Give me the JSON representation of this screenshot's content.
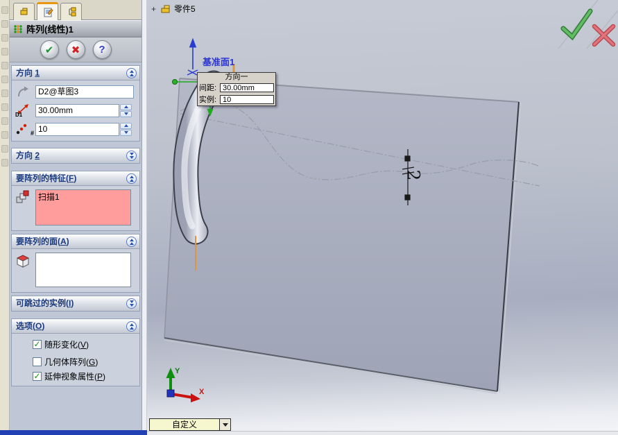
{
  "panel": {
    "title": "阵列(线性)1",
    "buttons": {
      "ok_glyph": "✔",
      "cancel_glyph": "✖",
      "help_glyph": "?"
    },
    "direction1": {
      "label": "方向 1",
      "direction_field": "D2@草图3",
      "spacing_value": "30.00mm",
      "spacing_icon_label": "D1",
      "count_value": "10",
      "count_icon_label": "#"
    },
    "direction2": {
      "label": "方向 2"
    },
    "features": {
      "label": "要阵列的特征(F)",
      "items": [
        "扫描1"
      ]
    },
    "faces": {
      "label": "要阵列的面(A)"
    },
    "skip": {
      "label": "可跳过的实例(I)"
    },
    "options": {
      "label": "选项(O)",
      "items": [
        {
          "label": "随形变化(V)",
          "checked": true,
          "glyph": "✓"
        },
        {
          "label": "几何体阵列(G)",
          "checked": false,
          "glyph": ""
        },
        {
          "label": "延伸视象属性(P)",
          "checked": true,
          "glyph": "✓"
        }
      ]
    }
  },
  "graphics": {
    "tree_expander": "+",
    "tree_item": "零件5",
    "plane_label": "基准面1",
    "callout": {
      "title": "方向一",
      "spacing_label": "间距:",
      "spacing_value": "30.00mm",
      "instances_label": "实例:",
      "instances_value": "10"
    },
    "dimension_label": "2",
    "triad": {
      "x_label": "X",
      "y_label": "Y"
    },
    "status_dropdown": "自定义"
  },
  "colors": {
    "accent_orange": "#e8950f",
    "selection_pink": "#ff9d9d",
    "ok_green": "#44a348",
    "cancel_red": "#d4646c",
    "plane_blue": "#2a35d4"
  }
}
